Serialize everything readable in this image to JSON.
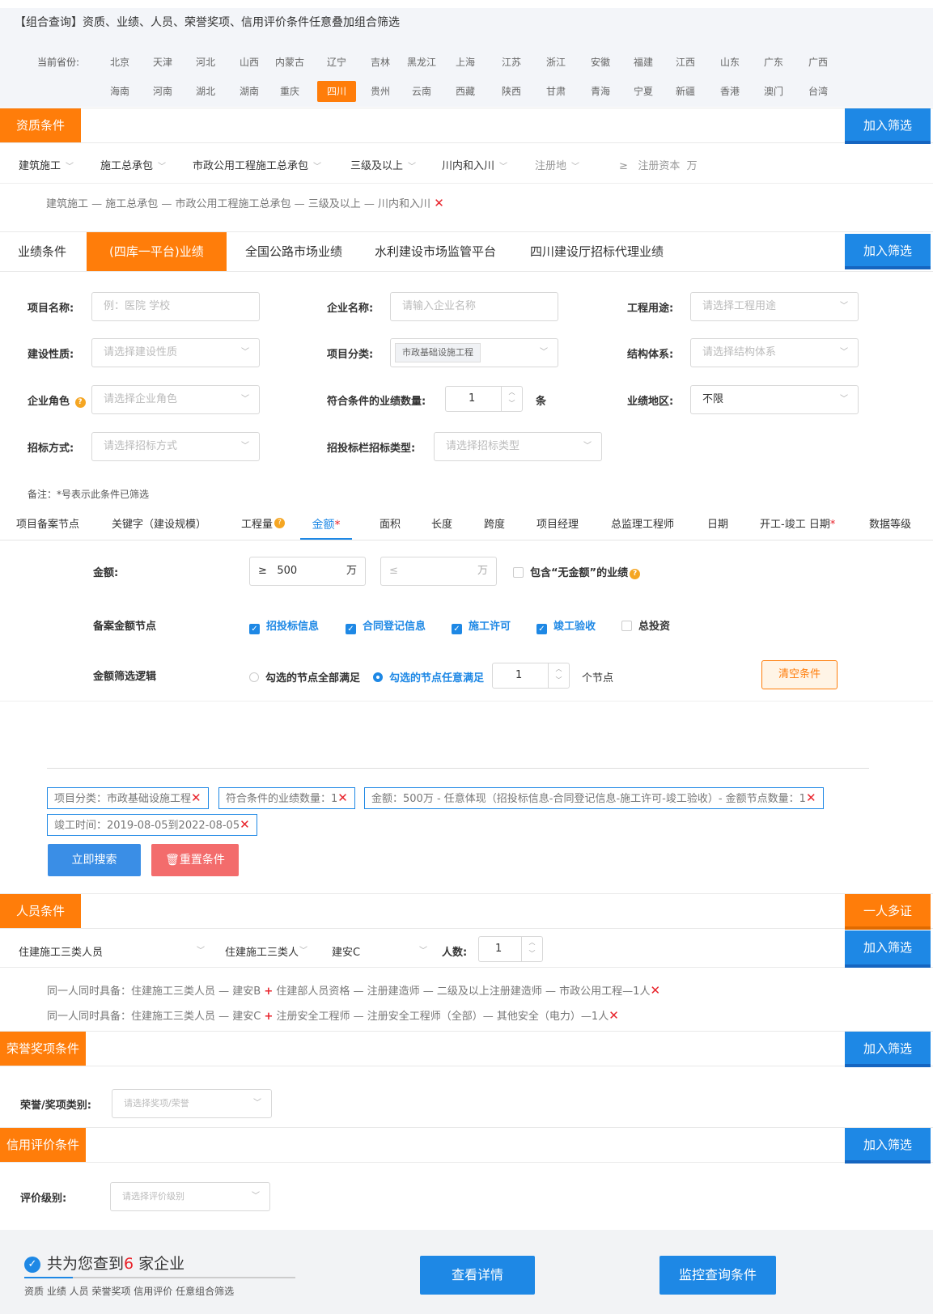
{
  "header": {
    "title": "【组合查询】资质、业绩、人员、荣誉奖项、信用评价条件任意叠加组合筛选"
  },
  "province": {
    "label": "当前省份:",
    "row1": [
      "北京",
      "天津",
      "河北",
      "山西",
      "内蒙古",
      "辽宁",
      "吉林",
      "黑龙江",
      "上海",
      "江苏",
      "浙江",
      "安徽",
      "福建",
      "江西",
      "山东",
      "广东",
      "广西"
    ],
    "row2": [
      "海南",
      "河南",
      "湖北",
      "湖南",
      "重庆",
      "四川",
      "贵州",
      "云南",
      "西藏",
      "陕西",
      "甘肃",
      "青海",
      "宁夏",
      "新疆",
      "香港",
      "澳门",
      "台湾"
    ],
    "selected": "四川"
  },
  "qualification": {
    "section_label": "资质条件",
    "add_label": "加入筛选",
    "dropdowns": [
      "建筑施工",
      "施工总承包",
      "市政公用工程施工总承包",
      "三级及以上",
      "川内和入川",
      "注册地"
    ],
    "capital_ge": "≥",
    "capital_label": "注册资本",
    "capital_unit": "万",
    "selected_path": "建筑施工 — 施工总承包 — 市政公用工程施工总承包 — 三级及以上 — 川内和入川"
  },
  "performance": {
    "section_label": "业绩条件",
    "tabs": [
      "(四库一平台)业绩",
      "全国公路市场业绩",
      "水利建设市场监管平台",
      "四川建设厅招标代理业绩"
    ],
    "add_label": "加入筛选",
    "fields": {
      "project_name_label": "项目名称:",
      "project_name_placeholder": "例：医院 学校",
      "company_name_label": "企业名称:",
      "company_name_placeholder": "请输入企业名称",
      "usage_label": "工程用途:",
      "usage_placeholder": "请选择工程用途",
      "nature_label": "建设性质:",
      "nature_placeholder": "请选择建设性质",
      "category_label": "项目分类:",
      "category_value": "市政基础设施工程",
      "structure_label": "结构体系:",
      "structure_placeholder": "请选择结构体系",
      "role_label": "企业角色",
      "role_placeholder": "请选择企业角色",
      "count_label": "符合条件的业绩数量:",
      "count_value": "1",
      "count_unit": "条",
      "region_label": "业绩地区:",
      "region_value": "不限",
      "bid_method_label": "招标方式:",
      "bid_method_placeholder": "请选择招标方式",
      "bid_type_label": "招投标栏招标类型:",
      "bid_type_placeholder": "请选择招标类型"
    },
    "note": "备注：*号表示此条件已筛选",
    "subtabs": [
      "项目备案节点",
      "关键字（建设规模）",
      "工程量",
      "金额",
      "面积",
      "长度",
      "跨度",
      "项目经理",
      "总监理工程师",
      "日期",
      "开工-竣工 日期",
      "数据等级"
    ],
    "subtab_req": "*",
    "qmark": "?",
    "amount": {
      "label": "金额:",
      "ge": "≥",
      "min": "500",
      "le": "≤",
      "unit": "万",
      "include_label": "包含“无金额”的业绩",
      "node_label": "备案金额节点",
      "nodes": [
        "招投标信息",
        "合同登记信息",
        "施工许可",
        "竣工验收",
        "总投资"
      ],
      "logic_label": "金额筛选逻辑",
      "logic_all": "勾选的节点全部满足",
      "logic_any": "勾选的节点任意满足",
      "logic_count": "1",
      "logic_unit": "个节点",
      "clear_label": "清空条件"
    },
    "chips": [
      "项目分类：市政基础设施工程",
      "符合条件的业绩数量：1",
      "金额：500万 - 任意体现（招投标信息-合同登记信息-施工许可-竣工验收）- 金额节点数量：1",
      "竣工时间：2019-08-05到2022-08-05"
    ],
    "search_label": "立即搜索",
    "reset_label": "重置条件"
  },
  "personnel": {
    "section_label": "人员条件",
    "multi_label": "一人多证",
    "add_label": "加入筛选",
    "dropdowns": [
      "住建施工三类人员",
      "住建施工三类人",
      "建安C"
    ],
    "count_label": "人数:",
    "count_value": "1",
    "conditions": [
      {
        "pre": "同一人同时具备：住建施工三类人员 — 建安B",
        "post": "住建部人员资格 — 注册建造师 — 二级及以上注册建造师 — 市政公用工程—1人"
      },
      {
        "pre": "同一人同时具备：住建施工三类人员 — 建安C",
        "post": "注册安全工程师 — 注册安全工程师（全部）— 其他安全（电力）—1人"
      }
    ]
  },
  "honor": {
    "section_label": "荣誉奖项条件",
    "add_label": "加入筛选",
    "field_label": "荣誉/奖项类别:",
    "placeholder": "请选择奖项/荣誉"
  },
  "credit": {
    "section_label": "信用评价条件",
    "add_label": "加入筛选",
    "field_label": "评价级别:",
    "placeholder": "请选择评价级别"
  },
  "result": {
    "prefix": "共为您查到",
    "count": "6",
    "suffix": " 家企业",
    "subtitle": "资质 业绩 人员 荣誉奖项 信用评价 任意组合筛选",
    "detail_label": "查看详情",
    "monitor_label": "监控查询条件"
  },
  "colors": {
    "accent": "#ff7d0a",
    "primary": "#1e88e5",
    "danger": "#e8232b",
    "reset": "#f36c6c"
  }
}
